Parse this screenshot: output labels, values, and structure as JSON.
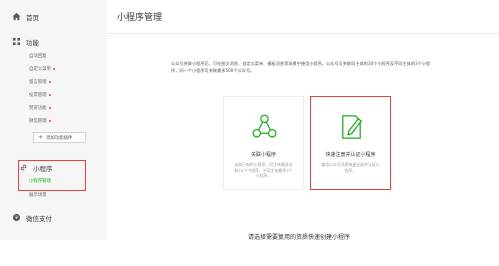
{
  "sidebar": {
    "home_label": "首页",
    "function_section": {
      "title": "功能",
      "items": [
        {
          "label": "自动回复",
          "badge": false
        },
        {
          "label": "自定义菜单",
          "badge": true
        },
        {
          "label": "留言管理",
          "badge": true
        },
        {
          "label": "投票管理",
          "badge": true
        },
        {
          "label": "赞赏功能",
          "badge": true
        },
        {
          "label": "微信管理",
          "badge": true
        }
      ],
      "add_plugin_label": "添加功能插件"
    },
    "miniprogram_section": {
      "title": "小程序",
      "items": [
        {
          "label": "小程序管理",
          "active": true
        },
        {
          "label": "展示场景",
          "active": false
        }
      ]
    },
    "pay_label": "微信支付"
  },
  "main": {
    "page_title": "小程序管理",
    "intro": "公众号关联小程序后，可在图文消息、自定义菜单、模板消息等场景中使用小程序。公众号可关联同主体的10个小程序及不同主体的3个小程序，同一个小程序可关联最多500个公众号。",
    "cards": [
      {
        "title": "关联小程序",
        "desc": "关联已有的小程序，同主体最多关联10个小程序，不同主体最多3个小程序。",
        "icon": "share-nodes-icon"
      },
      {
        "title": "快速注册并认证小程序",
        "desc": "复用公众号资质快速注册并认证小程序。",
        "icon": "edit-document-icon"
      }
    ],
    "bottom_hint": "请选择需要复用的资质快速创建小程序"
  },
  "colors": {
    "accent_green": "#1aad19",
    "highlight_red": "#e64340",
    "sidebar_bg": "#f6f6f6"
  }
}
